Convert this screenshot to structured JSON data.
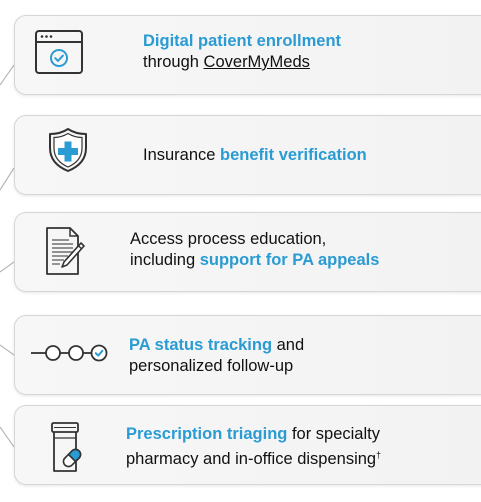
{
  "items": [
    {
      "icon": "browser-window-check-icon",
      "line1_hl": "Digital patient enrollment",
      "line2_pre": "through ",
      "line2_link": "CoverMyMeds"
    },
    {
      "icon": "shield-plus-icon",
      "pre": "Insurance ",
      "hl": "benefit verification"
    },
    {
      "icon": "document-pencil-icon",
      "line1": "Access process education,",
      "line2_pre": "including ",
      "line2_hl": "support for PA appeals"
    },
    {
      "icon": "progress-steps-icon",
      "line1_hl": "PA status tracking",
      "line1_post": " and",
      "line2": "personalized follow-up"
    },
    {
      "icon": "pill-bottle-icon",
      "line1_hl": "Prescription triaging",
      "line1_post": " for specialty",
      "line2": "pharmacy and in-office dispensing",
      "line2_sup": "†"
    }
  ],
  "colors": {
    "accent": "#2a9bd3",
    "icon_stroke": "#333333",
    "card_border": "#d6d6d6",
    "text": "#111111"
  }
}
